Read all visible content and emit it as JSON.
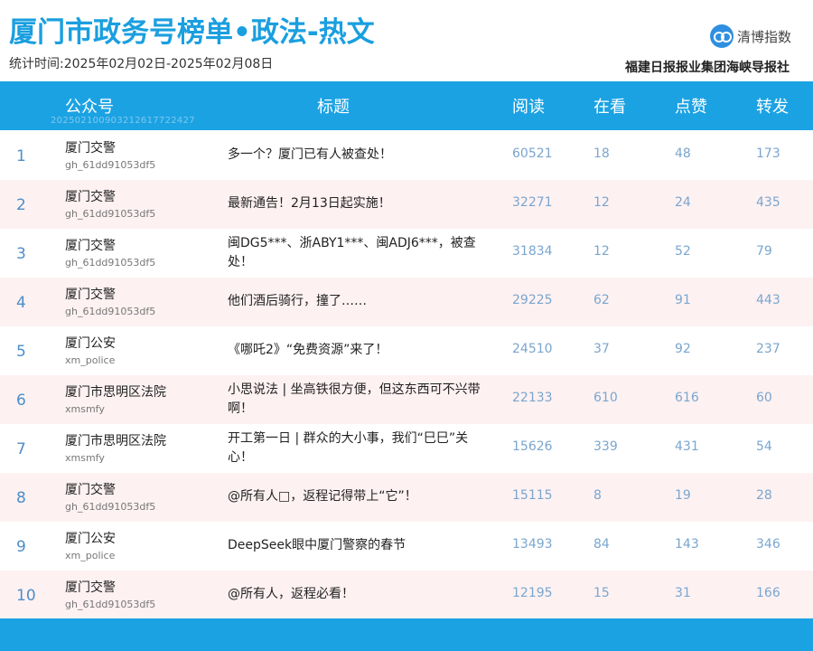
{
  "header": {
    "title": "厦门市政务号榜单•政法-热文",
    "period": "统计时间:2025年02月02日-2025年02月08日",
    "logo_text": "清博指数",
    "logo_icon": "infinity-logo-icon",
    "org": "福建日报报业集团海峡导报社"
  },
  "table": {
    "columns": [
      "公众号",
      "标题",
      "阅读",
      "在看",
      "点赞",
      "转发"
    ],
    "watermark": "20250210090321261772242​7",
    "rows": [
      {
        "rank": "1",
        "account": "厦门交警",
        "account_id": "gh_61dd91053df5",
        "title": "多一个？厦门已有人被查处！",
        "reads": "60521",
        "looking": "18",
        "likes": "48",
        "shares": "173"
      },
      {
        "rank": "2",
        "account": "厦门交警",
        "account_id": "gh_61dd91053df5",
        "title": "最新通告！2月13日起实施！",
        "reads": "32271",
        "looking": "12",
        "likes": "24",
        "shares": "435"
      },
      {
        "rank": "3",
        "account": "厦门交警",
        "account_id": "gh_61dd91053df5",
        "title": "闽DG5***、浙ABY1***、闽ADJ6***，被查处！",
        "reads": "31834",
        "looking": "12",
        "likes": "52",
        "shares": "79"
      },
      {
        "rank": "4",
        "account": "厦门交警",
        "account_id": "gh_61dd91053df5",
        "title": "他们酒后骑行，撞了……",
        "reads": "29225",
        "looking": "62",
        "likes": "91",
        "shares": "443"
      },
      {
        "rank": "5",
        "account": "厦门公安",
        "account_id": "xm_police",
        "title": "《哪吒2》“免费资源”来了！",
        "reads": "24510",
        "looking": "37",
        "likes": "92",
        "shares": "237"
      },
      {
        "rank": "6",
        "account": "厦门市思明区法院",
        "account_id": "xmsmfy",
        "title": "小思说法 | 坐高铁很方便，但这东西可不兴带啊！",
        "reads": "22133",
        "looking": "610",
        "likes": "616",
        "shares": "60"
      },
      {
        "rank": "7",
        "account": "厦门市思明区法院",
        "account_id": "xmsmfy",
        "title": "开工第一日 | 群众的大小事，我们“巳巳”关心！",
        "reads": "15626",
        "looking": "339",
        "likes": "431",
        "shares": "54"
      },
      {
        "rank": "8",
        "account": "厦门交警",
        "account_id": "gh_61dd91053df5",
        "title": "@所有人□，返程记得带上“它”！",
        "reads": "15115",
        "looking": "8",
        "likes": "19",
        "shares": "28"
      },
      {
        "rank": "9",
        "account": "厦门公安",
        "account_id": "xm_police",
        "title": "DeepSeek眼中厦门警察的春节",
        "reads": "13493",
        "looking": "84",
        "likes": "143",
        "shares": "346"
      },
      {
        "rank": "10",
        "account": "厦门交警",
        "account_id": "gh_61dd91053df5",
        "title": "@所有人，返程必看！",
        "reads": "12195",
        "looking": "15",
        "likes": "31",
        "shares": "166"
      }
    ]
  },
  "colors": {
    "accent": "#1ba2e3",
    "title": "#1a9fdf",
    "alt_row": "#fdf1f2",
    "numbers": "#7aa6cf"
  }
}
